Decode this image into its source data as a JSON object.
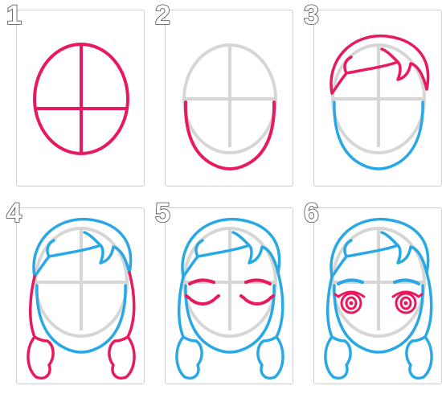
{
  "steps": [
    {
      "number": "1"
    },
    {
      "number": "2"
    },
    {
      "number": "3"
    },
    {
      "number": "4"
    },
    {
      "number": "5"
    },
    {
      "number": "6"
    }
  ],
  "colors": {
    "new_stroke": "#e8195f",
    "previous_stroke": "#29a8e6",
    "guide": "#d6d6d6",
    "panel_border": "#cfcfcf",
    "number_outline": "#4a4a4a"
  }
}
